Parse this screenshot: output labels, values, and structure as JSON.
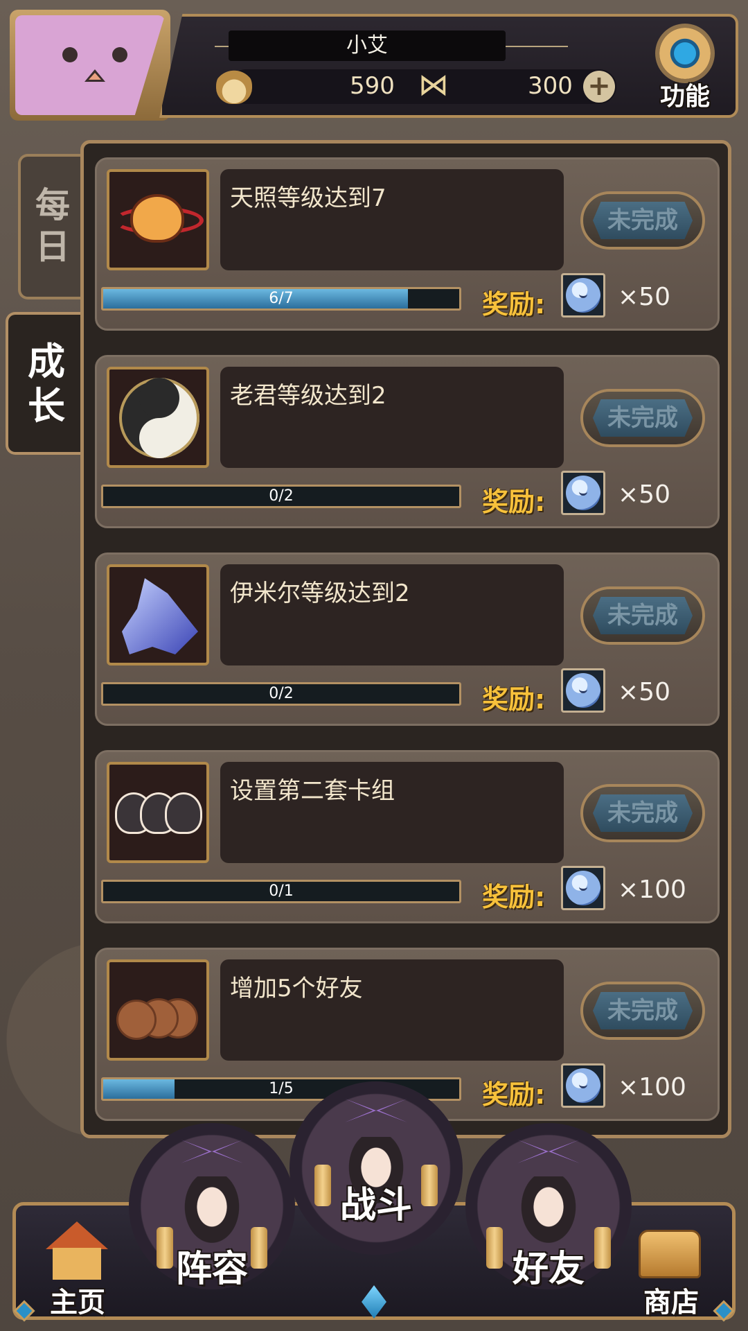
{
  "header": {
    "player_name": "小艾",
    "gold": "590",
    "gems": "300",
    "function_label": "功能"
  },
  "side_tabs": {
    "daily": "每日",
    "growth": "成长"
  },
  "quests": [
    {
      "title": "天照等级达到7",
      "progress_text": "6/7",
      "progress": 0.857,
      "status": "未完成",
      "reward_label": "奖励:",
      "reward_count": "×50",
      "icon": "sun-mascot-icon"
    },
    {
      "title": "老君等级达到2",
      "progress_text": "0/2",
      "progress": 0,
      "status": "未完成",
      "reward_label": "奖励:",
      "reward_count": "×50",
      "icon": "yin-yang-icon"
    },
    {
      "title": "伊米尔等级达到2",
      "progress_text": "0/2",
      "progress": 0,
      "status": "未完成",
      "reward_label": "奖励:",
      "reward_count": "×50",
      "icon": "crystal-icon"
    },
    {
      "title": "设置第二套卡组",
      "progress_text": "0/1",
      "progress": 0,
      "status": "未完成",
      "reward_label": "奖励:",
      "reward_count": "×100",
      "icon": "deck-girls-icon"
    },
    {
      "title": "增加5个好友",
      "progress_text": "1/5",
      "progress": 0.2,
      "status": "未完成",
      "reward_label": "奖励:",
      "reward_count": "×100",
      "icon": "bear-friends-icon"
    }
  ],
  "bottom_nav": {
    "home": "主页",
    "team": "阵容",
    "battle": "战斗",
    "friends": "好友",
    "shop": "商店"
  },
  "colors": {
    "accent_gold": "#f7c13b",
    "frame_gold": "#a9875d",
    "progress_blue": "#6bb8e0",
    "status_blue": "#4b6e84"
  }
}
